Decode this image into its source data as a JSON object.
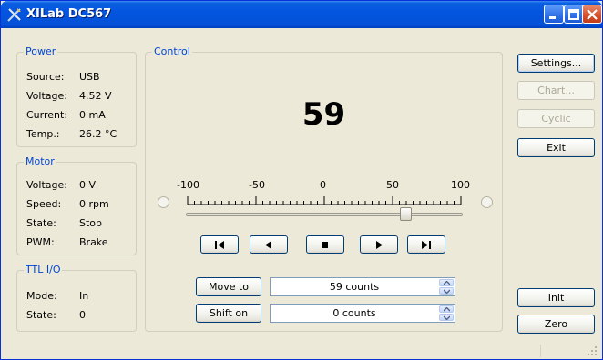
{
  "window": {
    "title": "XILab DC567"
  },
  "power": {
    "title": "Power",
    "rows": [
      {
        "label": "Source:",
        "value": "USB"
      },
      {
        "label": "Voltage:",
        "value": "4.52 V"
      },
      {
        "label": "Current:",
        "value": "0 mA"
      },
      {
        "label": "Temp.:",
        "value": "26.2 °C"
      }
    ]
  },
  "motor": {
    "title": "Motor",
    "rows": [
      {
        "label": "Voltage:",
        "value": "0 V"
      },
      {
        "label": "Speed:",
        "value": "0 rpm"
      },
      {
        "label": "State:",
        "value": "Stop"
      },
      {
        "label": "PWM:",
        "value": "Brake"
      }
    ]
  },
  "ttl": {
    "title": "TTL I/O",
    "rows": [
      {
        "label": "Mode:",
        "value": "In"
      },
      {
        "label": "State:",
        "value": "0"
      }
    ]
  },
  "control": {
    "title": "Control",
    "position": "59",
    "scale": {
      "min": "-100",
      "l1": "-50",
      "mid": "0",
      "r1": "50",
      "max": "100"
    },
    "slider_value": 59,
    "slider_range": [
      -100,
      100
    ],
    "move_to_label": "Move to",
    "move_to_value": "59 counts",
    "shift_on_label": "Shift on",
    "shift_on_value": "0 counts",
    "transport_icons": [
      "skip-to-start-icon",
      "step-left-icon",
      "stop-icon",
      "step-right-icon",
      "skip-to-end-icon"
    ]
  },
  "buttons": {
    "settings": "Settings...",
    "chart": "Chart...",
    "cyclic": "Cyclic",
    "exit": "Exit",
    "init": "Init",
    "zero": "Zero"
  },
  "colors": {
    "titlebar": "#0355e0",
    "group_title": "#0046d5",
    "window_bg": "#ece9d8"
  }
}
